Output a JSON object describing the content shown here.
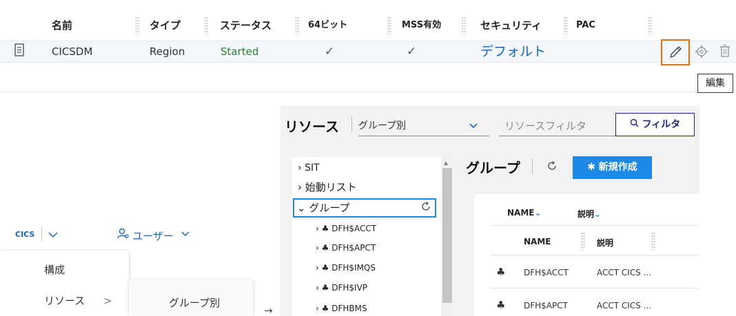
{
  "table": {
    "headers": [
      "名前",
      "タイプ",
      "ステータス",
      "64ビット",
      "MSS有効",
      "セキュリティ",
      "PAC"
    ],
    "row": {
      "name": "CICSDM",
      "type": "Region",
      "status": "Started",
      "bit64": "✓",
      "mss": "✓",
      "security": "デフォルト"
    },
    "tooltip": "編集",
    "row_icons": [
      "document-icon",
      "pencil-icon",
      "gear-icon",
      "trash-icon"
    ]
  },
  "nav": {
    "app": "CICS",
    "user_label": "ユーザー",
    "menu": [
      "構成",
      "リソース"
    ],
    "submenu": [
      "グループ別"
    ],
    "submenu_arrow": "→"
  },
  "resources": {
    "title": "リソース",
    "select_value": "グループ別",
    "filter_placeholder": "リソースフィルタ",
    "filter_button": "フィルタ",
    "tree": {
      "items": [
        "SIT",
        "始動リスト",
        "グループ"
      ],
      "children": [
        "DFH$ACCT",
        "DFH$APCT",
        "DFH$IMQS",
        "DFH$IVP",
        "DFHBMS"
      ]
    },
    "group_title": "グループ",
    "new_button": "新規作成",
    "sort": [
      "NAME",
      "説明"
    ],
    "columns": [
      "NAME",
      "説明"
    ],
    "rows": [
      {
        "name": "DFH$ACCT",
        "desc": "ACCT CICS ..."
      },
      {
        "name": "DFH$APCT",
        "desc": "ACCT CICS ..."
      }
    ]
  },
  "colors": {
    "accent_blue": "#1e88e5",
    "link_blue": "#1565c0",
    "status_green": "#2e7d32",
    "highlight_orange": "#e8710a"
  }
}
